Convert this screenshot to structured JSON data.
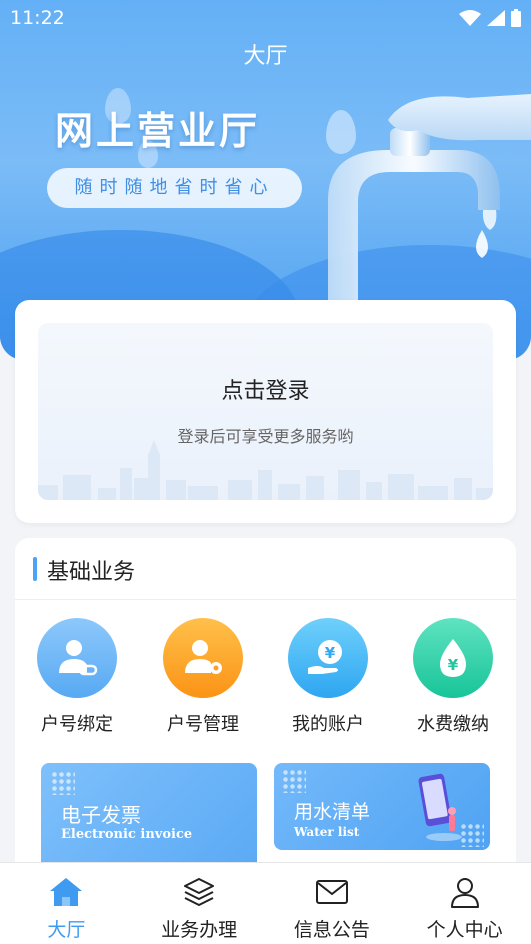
{
  "status_bar": {
    "time": "11:22"
  },
  "header": {
    "title": "大厅"
  },
  "banner": {
    "title": "网上营业厅",
    "slogan": "随时随地省时省心"
  },
  "login": {
    "title": "点击登录",
    "subtitle": "登录后可享受更多服务哟"
  },
  "services": {
    "section_title": "基础业务",
    "items": [
      {
        "label": "户号绑定",
        "icon": "user-link-icon"
      },
      {
        "label": "户号管理",
        "icon": "user-settings-icon"
      },
      {
        "label": "我的账户",
        "icon": "yuan-hand-icon"
      },
      {
        "label": "水费缴纳",
        "icon": "yuan-drop-icon"
      }
    ],
    "promos": [
      {
        "title": "电子发票",
        "subtitle": "Electronic invoice"
      },
      {
        "title": "用水清单",
        "subtitle": "Water list"
      }
    ]
  },
  "nav": {
    "items": [
      {
        "label": "大厅",
        "icon": "home-icon",
        "active": true
      },
      {
        "label": "业务办理",
        "icon": "layers-icon"
      },
      {
        "label": "信息公告",
        "icon": "mail-icon"
      },
      {
        "label": "个人中心",
        "icon": "person-icon"
      }
    ]
  },
  "colors": {
    "accent": "#3f9bf0",
    "banner": "#64b0f6"
  }
}
